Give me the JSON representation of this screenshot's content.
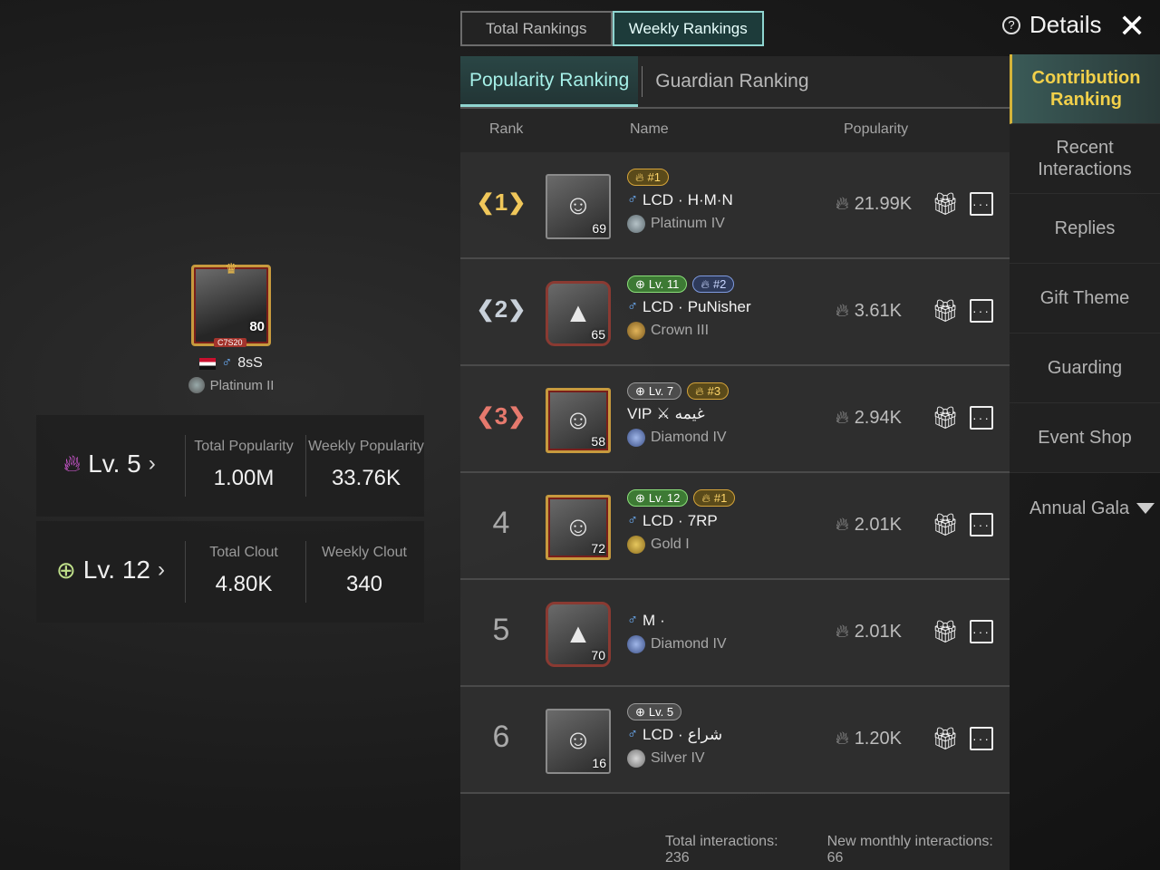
{
  "header": {
    "tabs": [
      {
        "label": "Total Rankings",
        "active": false
      },
      {
        "label": "Weekly Rankings",
        "active": true
      }
    ],
    "details_label": "Details",
    "help_icon": "help-circle-icon",
    "close_icon": "close-icon"
  },
  "sub_tabs": [
    {
      "label": "Popularity Ranking",
      "active": true
    },
    {
      "label": "Guardian Ranking",
      "active": false
    }
  ],
  "columns": {
    "rank": "Rank",
    "name": "Name",
    "popularity": "Popularity"
  },
  "rows": [
    {
      "rank": "1",
      "avatar_level": "69",
      "badges": [
        {
          "type": "fire",
          "text": "#1"
        }
      ],
      "clan": "LCD",
      "name": "H·M·N",
      "tier": "Platinum IV",
      "popularity": "21.99K"
    },
    {
      "rank": "2",
      "avatar_level": "65",
      "badges": [
        {
          "type": "green",
          "text": "Lv. 11"
        },
        {
          "type": "blue",
          "text": "#2"
        }
      ],
      "clan": "LCD",
      "name": "PuNisher",
      "tier": "Crown III",
      "popularity": "3.61K"
    },
    {
      "rank": "3",
      "avatar_level": "58",
      "badges": [
        {
          "type": "gray",
          "text": "Lv. 7"
        },
        {
          "type": "fire",
          "text": "#3"
        }
      ],
      "clan": "VIP",
      "name": "غيمه",
      "tier": "Diamond IV",
      "popularity": "2.94K"
    },
    {
      "rank": "4",
      "avatar_level": "72",
      "badges": [
        {
          "type": "green",
          "text": "Lv. 12"
        },
        {
          "type": "fire",
          "text": "#1"
        }
      ],
      "clan": "LCD",
      "name": "7RP",
      "tier": "Gold I",
      "popularity": "2.01K"
    },
    {
      "rank": "5",
      "avatar_level": "70",
      "badges": [],
      "clan": "M",
      "name": "",
      "tier": "Diamond IV",
      "popularity": "2.01K"
    },
    {
      "rank": "6",
      "avatar_level": "16",
      "badges": [
        {
          "type": "gray",
          "text": "Lv. 5"
        }
      ],
      "clan": "LCD",
      "name": "شراع",
      "tier": "Silver IV",
      "popularity": "1.20K"
    }
  ],
  "footer": {
    "total_interactions": "Total interactions: 236",
    "monthly_interactions": "New monthly interactions: 66"
  },
  "profile": {
    "avatar_level": "80",
    "avatar_tag": "C7S20",
    "name": "8sS",
    "tier": "Platinum II",
    "popularity": {
      "level": "Lv. 5",
      "total_label": "Total Popularity",
      "total_value": "1.00M",
      "weekly_label": "Weekly Popularity",
      "weekly_value": "33.76K"
    },
    "clout": {
      "level": "Lv. 12",
      "total_label": "Total Clout",
      "total_value": "4.80K",
      "weekly_label": "Weekly Clout",
      "weekly_value": "340"
    }
  },
  "side_nav": [
    {
      "label": "Contribution Ranking",
      "active": true
    },
    {
      "label": "Recent Interactions",
      "active": false
    },
    {
      "label": "Replies",
      "active": false
    },
    {
      "label": "Gift Theme",
      "active": false
    },
    {
      "label": "Guarding",
      "active": false
    },
    {
      "label": "Event Shop",
      "active": false
    },
    {
      "label": "Annual Gala",
      "active": false
    }
  ],
  "colors": {
    "accent": "#8fd5d0",
    "active_nav": "#f2d04a",
    "male": "#6fb3ff"
  }
}
